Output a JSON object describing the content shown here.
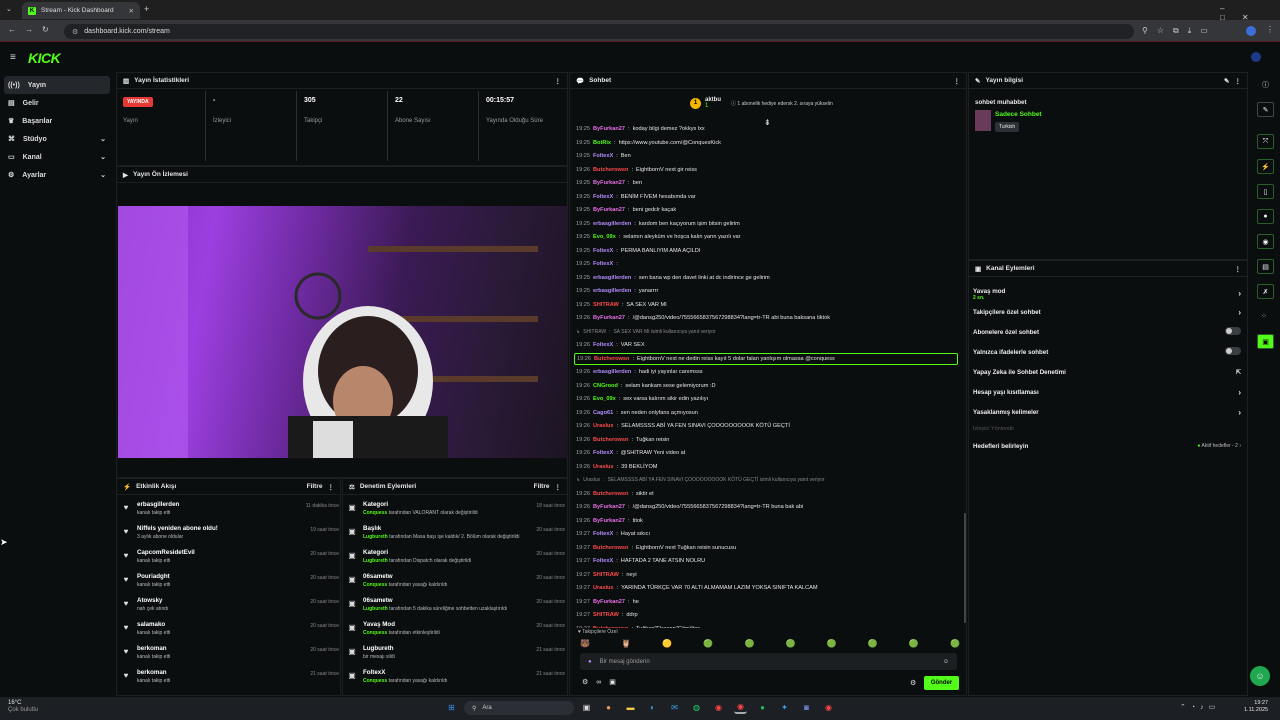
{
  "browser": {
    "tab_title": "Stream - Kick Dashboard",
    "url": "dashboard.kick.com/stream"
  },
  "nav": {
    "items": [
      {
        "label": "Yayın",
        "icon": "broadcast-icon"
      },
      {
        "label": "Gelir",
        "icon": "wallet-icon"
      },
      {
        "label": "Başarılar",
        "icon": "trophy-icon"
      },
      {
        "label": "Stüdyo",
        "icon": "studio-icon"
      },
      {
        "label": "Kanal",
        "icon": "channel-icon"
      },
      {
        "label": "Ayarlar",
        "icon": "gear-icon"
      }
    ]
  },
  "stats": {
    "title": "Yayın İstatistikleri",
    "live_badge": "YAYINDA",
    "items": [
      {
        "value": "",
        "label": "Yayın"
      },
      {
        "value": "-",
        "label": "İzleyici"
      },
      {
        "value": "305",
        "label": "Takipçi"
      },
      {
        "value": "22",
        "label": "Abone Sayısı"
      },
      {
        "value": "00:15:57",
        "label": "Yayında Olduğu Süre"
      }
    ]
  },
  "preview": {
    "title": "Yayın Ön İzlemesi"
  },
  "activity": {
    "title": "Etkinlik Akışı",
    "filter": "Filtre",
    "items": [
      {
        "name": "erbasgillerden",
        "desc": "kanalı takip etti",
        "time": "11 dakika önce"
      },
      {
        "name": "Niffels yeniden abone oldu!",
        "desc": "3 aylık abone oldular",
        "time": "19 saat önce"
      },
      {
        "name": "CapcomResidetEvil",
        "desc": "kanalı takip etti",
        "time": "20 saat önce"
      },
      {
        "name": "Pouriadght",
        "desc": "kanalı takip etti",
        "time": "20 saat önce"
      },
      {
        "name": "Atowsky",
        "desc": "nah çek atındı",
        "time": "20 saat önce"
      },
      {
        "name": "salamako",
        "desc": "kanalı takip etti",
        "time": "20 saat önce"
      },
      {
        "name": "berkoman",
        "desc": "kanalı takip etti",
        "time": "20 saat önce"
      },
      {
        "name": "berkoman",
        "desc": "kanalı takip etti",
        "time": "21 saat önce"
      }
    ]
  },
  "moderation": {
    "title": "Denetim Eylemleri",
    "filter": "Filtre",
    "items": [
      {
        "name": "Kategori",
        "who": "Conquess",
        "desc": "tarafından VALORANT olarak değiştirildi",
        "time": "18 saat önce"
      },
      {
        "name": "Başlık",
        "who": "Lugbureth",
        "desc": "tarafından Masa başı işe kaldık/ 2. Bölüm olarak değiştirildi",
        "time": "20 saat önce"
      },
      {
        "name": "Kategori",
        "who": "Lugbureth",
        "desc": "tarafından Dispatch olarak değiştirildi",
        "time": "20 saat önce"
      },
      {
        "name": "06sametw",
        "who": "Conquess",
        "desc": "tarafından yasağı kaldırıldı",
        "time": "20 saat önce"
      },
      {
        "name": "06sametw",
        "who": "Lugbureth",
        "desc": "tarafından 5 dakika süreliğine sohbetten uzaklaştırıldı",
        "time": "20 saat önce"
      },
      {
        "name": "Yavaş Mod",
        "who": "Conquess",
        "desc": "tarafından etkinleştirildi",
        "time": "20 saat önce"
      },
      {
        "name": "Lugbureth",
        "who": "",
        "desc": "bir mesajı sildi",
        "time": "21 saat önce"
      },
      {
        "name": "FoltexX",
        "who": "Conquess",
        "desc": "tarafından yasağı kaldırıldı",
        "time": "21 saat önce"
      }
    ]
  },
  "chat": {
    "title": "Sohbet",
    "top_user": "aktbu",
    "top_count": "1",
    "goal": "1 abonelik hediye edersk 2. sıraya yükselin",
    "follower_label": "Takipçilere Özel",
    "placeholder": "Bir mesaj gönderin",
    "send": "Gönder",
    "messages": [
      {
        "t": "19:25",
        "u": "ByFurkan27",
        "c": "#e86fe8",
        "m": "koday bilgi demez ?okkys lxx"
      },
      {
        "t": "19:25",
        "u": "BotRix",
        "c": "#53fc18",
        "m": "https://www.youtube.com/@ConquesKick"
      },
      {
        "t": "19:25",
        "u": "FoltexX",
        "c": "#b48cff",
        "m": "Ben"
      },
      {
        "t": "19:26",
        "u": "Butcherowsn",
        "c": "#ff4a4a",
        "m": "EightbornV next gir reiss"
      },
      {
        "t": "19:25",
        "u": "ByFurkan27",
        "c": "#e86fe8",
        "m": "ben"
      },
      {
        "t": "19:25",
        "u": "FoltexX",
        "c": "#b48cff",
        "m": "BENİM FİVEM hesabımda var"
      },
      {
        "t": "19:25",
        "u": "ByFurkan27",
        "c": "#e86fe8",
        "m": "beni gedclr kaçak"
      },
      {
        "t": "19:25",
        "u": "erbasgillerden",
        "c": "#b48cff",
        "m": "kardom ben kaçıyorum işim bitsin gelirim"
      },
      {
        "t": "19:25",
        "u": "Evo_09x",
        "c": "#53fc18",
        "m": "selamın aleyküm ve hoşca kalın yarın yazılı var"
      },
      {
        "t": "19:25",
        "u": "FoltexX",
        "c": "#b48cff",
        "m": "PERMA BANLIYIM AMA AÇILDI"
      },
      {
        "t": "19:25",
        "u": "FoltexX",
        "c": "#b48cff",
        "m": ""
      },
      {
        "t": "19:25",
        "u": "erbasgillerden",
        "c": "#b48cff",
        "m": "sen bana wp den davet linki at dc indirince ge gelirim"
      },
      {
        "t": "19:25",
        "u": "erbasgillerden",
        "c": "#b48cff",
        "m": "yanarrrr"
      },
      {
        "t": "19:25",
        "u": "SHITRAW",
        "c": "#ff4a4a",
        "m": "SA SEX VAR MI"
      },
      {
        "t": "19:26",
        "u": "ByFurkan27",
        "c": "#e86fe8",
        "m": "/@dansg250/video/7555665837567298834?lang=tr-TR abi buna baksana tiktok"
      },
      {
        "t": "",
        "u": "SHITRAW",
        "c": "#999",
        "m": "SA SEX VAR MI isimli kullanıcıya yanıt veriyor"
      },
      {
        "t": "19:26",
        "u": "FoltexX",
        "c": "#b48cff",
        "m": "VAR SEX"
      },
      {
        "t": "19:26",
        "u": "Butcherowsn",
        "c": "#ff4a4a",
        "m": "EightbornV next ne dedin reiss kayıt 5 dolar falan yanlışım olmassa @conquess"
      },
      {
        "t": "19:26",
        "u": "erbasgillerden",
        "c": "#b48cff",
        "m": "hadi iyi yayınlar canımsss"
      },
      {
        "t": "19:26",
        "u": "CNGrood",
        "c": "#53fc18",
        "m": "selam kankam sese gelemiyorum :D"
      },
      {
        "t": "19:26",
        "u": "Evo_09x",
        "c": "#53fc18",
        "m": "sex varsa kalırım sikir edin yazılıyı"
      },
      {
        "t": "19:26",
        "u": "Cago61",
        "c": "#b48cff",
        "m": "sen neden onlyfans açmıyosun"
      },
      {
        "t": "19:26",
        "u": "Uraslux",
        "c": "#ff4a4a",
        "m": "SELAMSSSS ABİ YA FEN SINAVI ÇOOOOOOOOOK KÖTÜ GEÇTİ"
      },
      {
        "t": "19:26",
        "u": "Butcherowsn",
        "c": "#ff4a4a",
        "m": "Tuğkan reisin"
      },
      {
        "t": "19:26",
        "u": "FoltexX",
        "c": "#b48cff",
        "m": "@SHITRAW Yeni video at"
      },
      {
        "t": "19:26",
        "u": "Uraslux",
        "c": "#ff4a4a",
        "m": "39 BEKLİYOM"
      },
      {
        "t": "",
        "u": "Uraslux",
        "c": "#999",
        "m": "SELAMSSSS ABİ YA FEN SINAVI ÇOOOOOOOOOK KÖTÜ GEÇTİ isimli kullanıcıya yanıt veriyor"
      },
      {
        "t": "19:26",
        "u": "Butcherowsn",
        "c": "#ff4a4a",
        "m": "siktir et"
      },
      {
        "t": "19:26",
        "u": "ByFurkan27",
        "c": "#e86fe8",
        "m": "/@dansg250/video/7555665837567298834?lang=tr-TR buna bak abi"
      },
      {
        "t": "19:26",
        "u": "ByFurkan27",
        "c": "#e86fe8",
        "m": "titok"
      },
      {
        "t": "19:27",
        "u": "FoltexX",
        "c": "#b48cff",
        "m": "Hayat sıkıcı"
      },
      {
        "t": "19:27",
        "u": "Butcherowsn",
        "c": "#ff4a4a",
        "m": "EightbornV next Tuğkan reisin sunucusu"
      },
      {
        "t": "19:27",
        "u": "FoltexX",
        "c": "#b48cff",
        "m": "HAFTADA 2 TANE ATSIN NOLRU"
      },
      {
        "t": "19:27",
        "u": "SHITRAW",
        "c": "#ff4a4a",
        "m": "neyi"
      },
      {
        "t": "19:27",
        "u": "Uraslux",
        "c": "#ff4a4a",
        "m": "YARINDA TÜRKÇE VAR 70 ALTI ALMAMAM LAZIM YOKSA SINIFTA KALCAM"
      },
      {
        "t": "19:27",
        "u": "ByFurkan27",
        "c": "#e86fe8",
        "m": "he"
      },
      {
        "t": "19:27",
        "u": "SHITRAW",
        "c": "#ff4a4a",
        "m": "ddrp"
      },
      {
        "t": "19:27",
        "u": "Butcherowsn",
        "c": "#ff4a4a",
        "m": "Tuğkan\"Elraenn\"Gönültaş"
      }
    ]
  },
  "stream_info": {
    "title": "Yayın bilgisi",
    "stream_title": "sohbet muhabbet",
    "category": "Sadece Sohbet",
    "tag": "Turkish"
  },
  "channel_actions": {
    "title": "Kanal Eylemleri",
    "slow_mode": "Yavaş mod",
    "slow_value": "2 sn.",
    "items": [
      "Takipçilere özel sohbet",
      "Abonelere özel sohbet",
      "Yalnızca ifadelerle sohbet",
      "Yapay Zeka ile Sohbet Denetimi",
      "Hesap yaşı kısıtlaması",
      "Yasaklanmış kelimeler"
    ],
    "viewer_dir": "İzleyici Yönlendir",
    "goals": "Hedefleri belirleyin",
    "goals_status": "Aktif hedefler - 2"
  },
  "taskbar": {
    "weather_temp": "16°C",
    "weather_desc": "Çok bulutlu",
    "search": "Ara",
    "time": "19:27",
    "date": "1.11.2025"
  },
  "colors": {
    "accent": "#53fc18",
    "live": "#e53935"
  }
}
